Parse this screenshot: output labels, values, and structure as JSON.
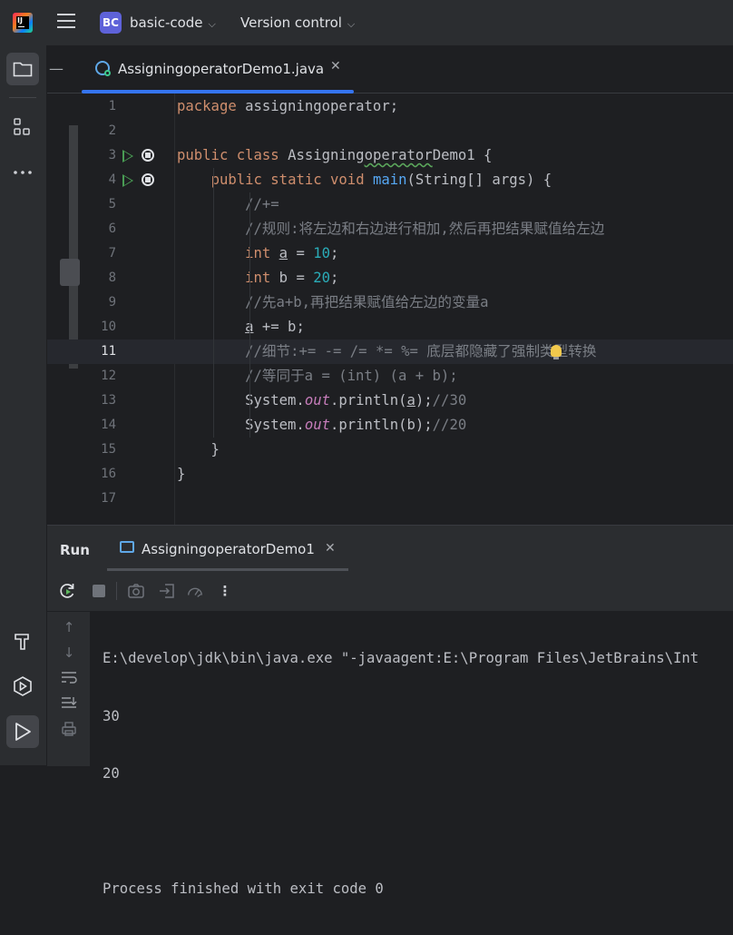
{
  "titlebar": {
    "project_badge": "BC",
    "project_name": "basic-code",
    "vcs_label": "Version control"
  },
  "sidebar": {
    "icons": [
      "folder-icon",
      "structure-icon",
      "more-icon",
      "build-hammer-icon",
      "services-icon",
      "run-icon"
    ]
  },
  "editor": {
    "tab_label": "AssigningoperatorDemo1.java",
    "current_line": 11,
    "line_numbers": [
      "1",
      "2",
      "3",
      "4",
      "5",
      "6",
      "7",
      "8",
      "9",
      "10",
      "11",
      "12",
      "13",
      "14",
      "15",
      "16",
      "17"
    ]
  },
  "code_lines": [
    "package assigningoperator;",
    "",
    "public class AssigningoperatorDemo1 {",
    "    public static void main(String[] args) {",
    "        //+=",
    "        //规则:将左边和右边进行相加,然后再把结果赋值给左边",
    "        int a = 10;",
    "        int b = 20;",
    "        //先a+b,再把结果赋值给左边的变量a",
    "        a += b;",
    "        //细节:+= -= /= *= %= 底层都隐藏了强制类型转换",
    "        //等同于a = (int) (a + b);",
    "        System.out.println(a);//30",
    "        System.out.println(b);//20",
    "    }",
    "}",
    ""
  ],
  "run_panel": {
    "title": "Run",
    "tab_label": "AssigningoperatorDemo1",
    "console_lines": [
      "E:\\develop\\jdk\\bin\\java.exe \"-javaagent:E:\\Program Files\\JetBrains\\Int",
      "30",
      "20",
      "",
      "Process finished with exit code 0"
    ]
  },
  "colors": {
    "keyword": "#cf8e6d",
    "comment": "#7a7e85",
    "number": "#2aacb8",
    "method": "#56a8f5",
    "static_field": "#c77dbb",
    "accent": "#3574f0",
    "run_green": "#499c54"
  }
}
